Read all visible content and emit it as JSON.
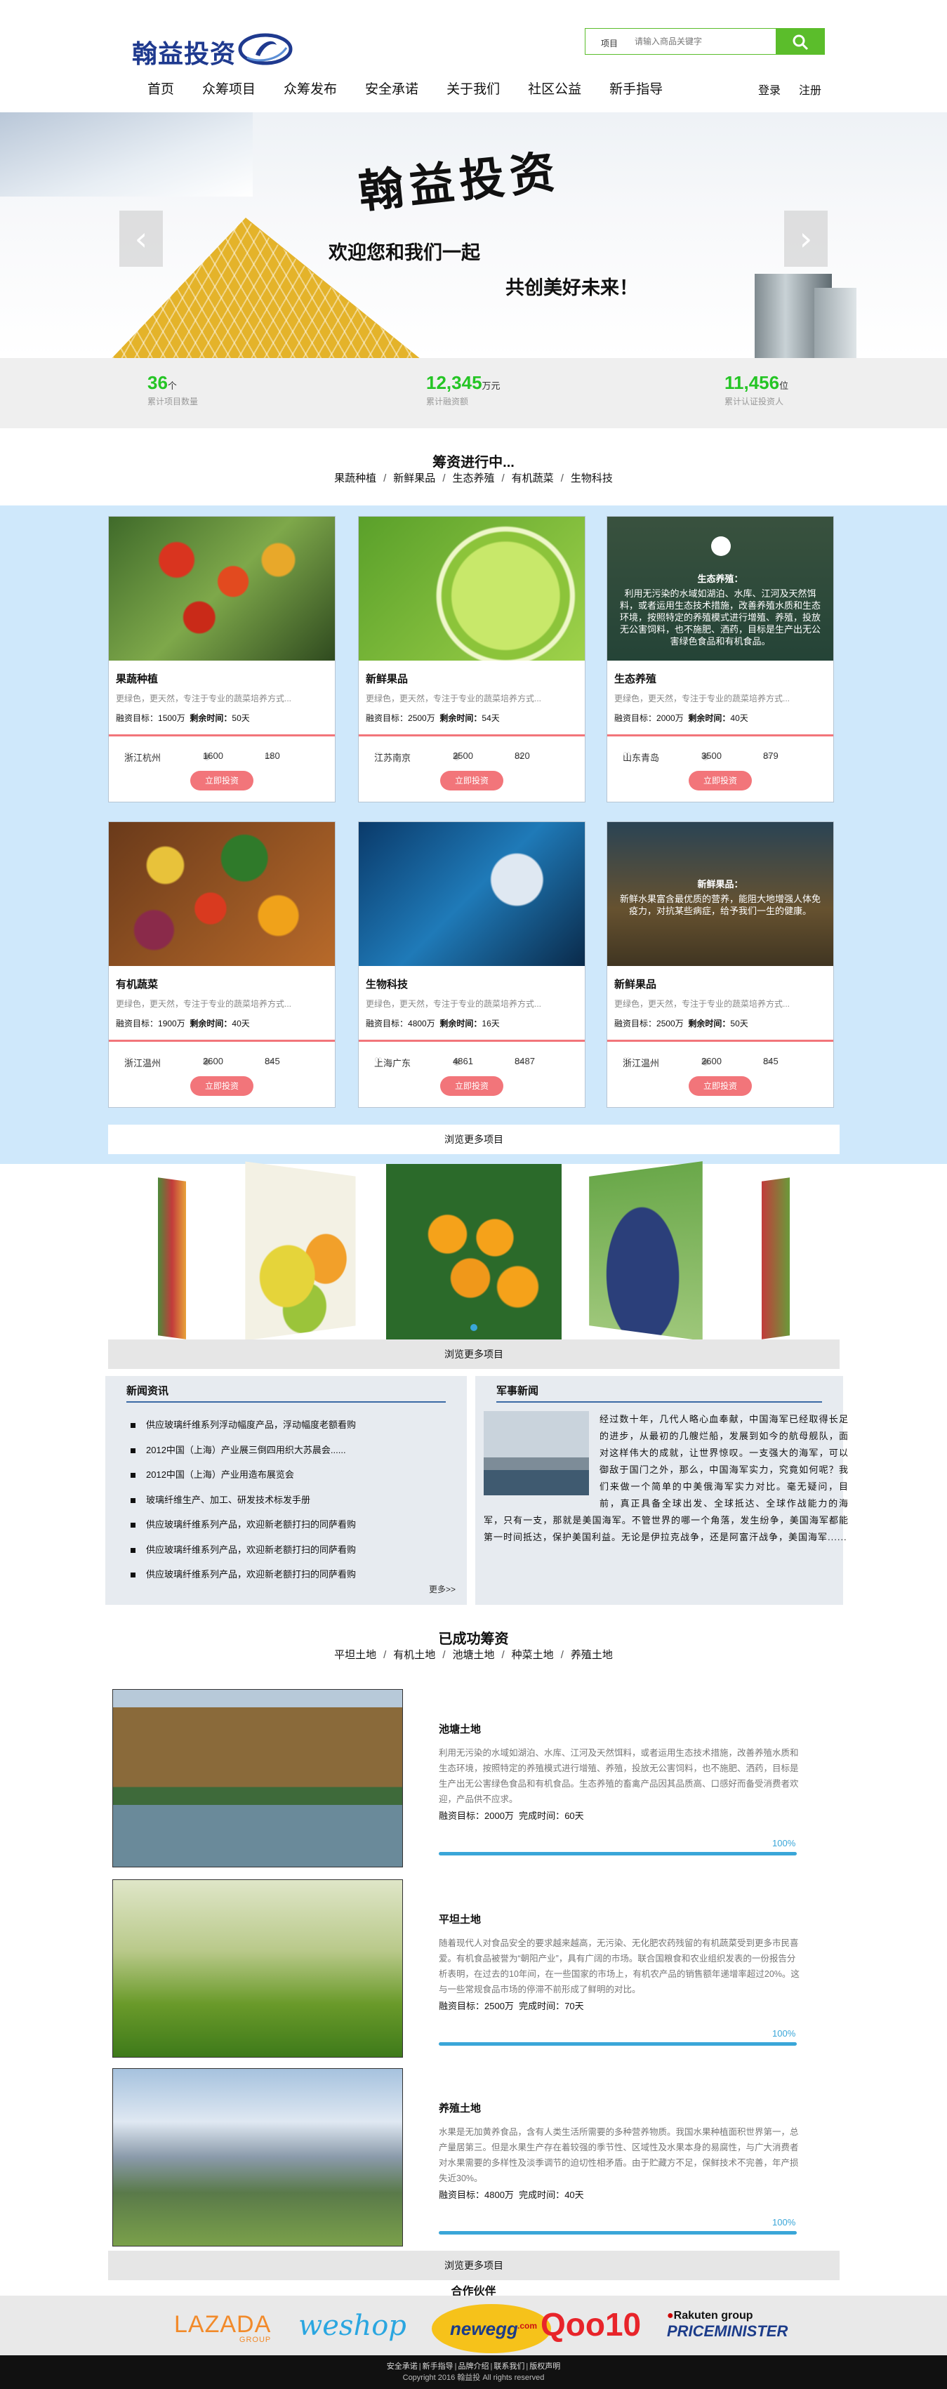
{
  "header": {
    "logo_text": "翰益投资",
    "search_label": "项目",
    "search_placeholder": "请输入商品关键字",
    "nav": [
      "首页",
      "众筹项目",
      "众筹发布",
      "安全承诺",
      "关于我们",
      "社区公益",
      "新手指导"
    ],
    "login": "登录",
    "register": "注册"
  },
  "banner": {
    "title": "翰益投资",
    "line1": "欢迎您和我们一起",
    "line2": "共创美好未来！",
    "prev": "‹",
    "next": "›"
  },
  "stats": [
    {
      "num": "36",
      "unit": "个",
      "label": "累计项目数量"
    },
    {
      "num": "12,345",
      "unit": "万元",
      "label": "累计融资额"
    },
    {
      "num": "11,456",
      "unit": "位",
      "label": "累计认证投资人"
    }
  ],
  "projects_section": {
    "title": "筹资进行中...",
    "cats": [
      "果蔬种植",
      "新鲜果品",
      "生态养殖",
      "有机蔬菜",
      "生物科技"
    ]
  },
  "cards": [
    {
      "title": "果蔬种植",
      "desc": "更绿色，更天然，专注于专业的蔬菜培养方式...",
      "target": "1500万",
      "remain": "50天",
      "loc": "浙江杭州",
      "views": "1600",
      "comments": "180",
      "btn": "立即投资"
    },
    {
      "title": "新鲜果品",
      "desc": "更绿色，更天然，专注于专业的蔬菜培养方式...",
      "target": "2500万",
      "remain": "54天",
      "loc": "江苏南京",
      "views": "2500",
      "comments": "820",
      "btn": "立即投资"
    },
    {
      "title": "生态养殖",
      "desc": "更绿色，更天然，专注于专业的蔬菜培养方式...",
      "target": "2000万",
      "remain": "40天",
      "loc": "山东青岛",
      "views": "3500",
      "comments": "879",
      "btn": "立即投资",
      "overlay_title": "生态养殖：",
      "overlay_text": "利用无污染的水域如湖泊、水库、江河及天然饵料，或者运用生态技术措施，改善养殖水质和生态环境，按照特定的养殖模式进行增殖、养殖，投放无公害饲料，也不施肥、洒药，目标是生产出无公害绿色食品和有机食品。"
    },
    {
      "title": "有机蔬菜",
      "desc": "更绿色，更天然，专注于专业的蔬菜培养方式...",
      "target": "1900万",
      "remain": "40天",
      "loc": "浙江温州",
      "views": "2600",
      "comments": "845",
      "btn": "立即投资"
    },
    {
      "title": "生物科技",
      "desc": "更绿色，更天然，专注于专业的蔬菜培养方式...",
      "target": "4800万",
      "remain": "16天",
      "loc": "上海广东",
      "views": "4861",
      "comments": "8487",
      "btn": "立即投资"
    },
    {
      "title": "新鲜果品",
      "desc": "更绿色，更天然，专注于专业的蔬菜培养方式...",
      "target": "2500万",
      "remain": "50天",
      "loc": "浙江温州",
      "views": "2600",
      "comments": "845",
      "btn": "立即投资",
      "overlay_title": "新鲜果品：",
      "overlay_text": "新鲜水果富含最优质的营养，能阻大地增强人体免疫力，对抗某些病症，给予我们一生的健康。"
    }
  ],
  "labels": {
    "target": "融资目标：",
    "remain": "剩余时间：",
    "done": "完成时间："
  },
  "more": "浏览更多项目",
  "news": {
    "title": "新闻资讯",
    "items": [
      "供应玻璃纤维系列浮动幅度产品，浮动幅度老额看购",
      "2012中国（上海）产业展三倒四用织大苏晨会......",
      "2012中国（上海）产业用造布展览会",
      "玻璃纤维生产、加工、研发技术标发手册",
      "供应玻璃纤维系列产品，欢迎新老额打扫的同萨看购",
      "供应玻璃纤维系列产品，欢迎新老额打扫的同萨看购",
      "供应玻璃纤维系列产品，欢迎新老额打扫的同萨看购"
    ],
    "more": "更多>>"
  },
  "military": {
    "title": "军事新闻",
    "text": "经过数十年，几代人略心血奉献，中国海军已经取得长足的进步，从最初的几艘烂船，发展到如今的航母舰队，面对这样伟大的成就，让世界惊叹。一支强大的海军，可以御敌于国门之外，那么，中国海军实力，究竟如何呢？我们来做一个简单的中美俄海军实力对比。毫无疑问，目前，真正具备全球出发、全球抵达、全球作战能力的海军，只有一支，那就是美国海军。不管世界的哪一个角落，发生纷争，美国海军都能第一时间抵达，保护美国利益。无论是伊拉克战争，还是阿富汗战争，美国海军......"
  },
  "success_section": {
    "title": "已成功筹资",
    "cats": [
      "平坦土地",
      "有机土地",
      "池塘土地",
      "种菜土地",
      "养殖土地"
    ]
  },
  "success": [
    {
      "title": "池塘土地",
      "desc": "利用无污染的水域如湖泊、水库、江河及天然饵料，或者运用生态技术措施，改善养殖水质和生态环境，按照特定的养殖模式进行增殖、养殖，投放无公害饲料，也不施肥、洒药，目标是生产出无公害绿色食品和有机食品。生态养殖的畜禽产品因其品质高、口感好而备受消费者欢迎，产品供不应求。",
      "target": "2000万",
      "done": "60天",
      "pct": "100%",
      "progress": 1.0
    },
    {
      "title": "平坦土地",
      "desc": "随着现代人对食品安全的要求越来越高，无污染、无化肥农药残留的有机蔬菜受到更多市民喜爱。有机食品被誉为“朝阳产业”，具有广阔的市场。联合国粮食和农业组织发表的一份报告分析表明，在过去的10年间，在一些国家的市场上，有机农产品的销售额年递增率超过20%。这与一些常规食品市场的停滞不前形成了鲜明的对比。",
      "target": "2500万",
      "done": "70天",
      "pct": "100%",
      "progress": 1.0
    },
    {
      "title": "养殖土地",
      "desc": "水果是无加黄养食品，含有人类生活所需要的多种营养物质。我国水果种植面积世界第一，总产量居第三。但是水果生产存在着较强的季节性、区域性及水果本身的易腐性，与广大消费者对水果需要的多样性及淡季调节的迫切性相矛盾。由于贮藏方不足，保鲜技术不完善，年产损失近30%。",
      "target": "4800万",
      "done": "40天",
      "pct": "100%",
      "progress": 1.0
    }
  ],
  "partners": {
    "title": "合作伙伴",
    "names": [
      "LAZADA",
      "GROUP",
      "weshop",
      "newegg",
      ".com",
      "Qoo10",
      "Rakuten group",
      "PRICEMINISTER"
    ]
  },
  "footer": {
    "links": [
      "安全承诺",
      "新手指导",
      "品牌介绍",
      "联系我们",
      "版权声明"
    ],
    "copyright": "Copyright 2016 翰益投 All rights reserved"
  },
  "colors": {
    "green": "#5bbd2b",
    "stat_green": "#25c525",
    "pink": "#f2757a",
    "light_blue": "#cfe8fb",
    "progress_blue": "#3aa6d8"
  }
}
